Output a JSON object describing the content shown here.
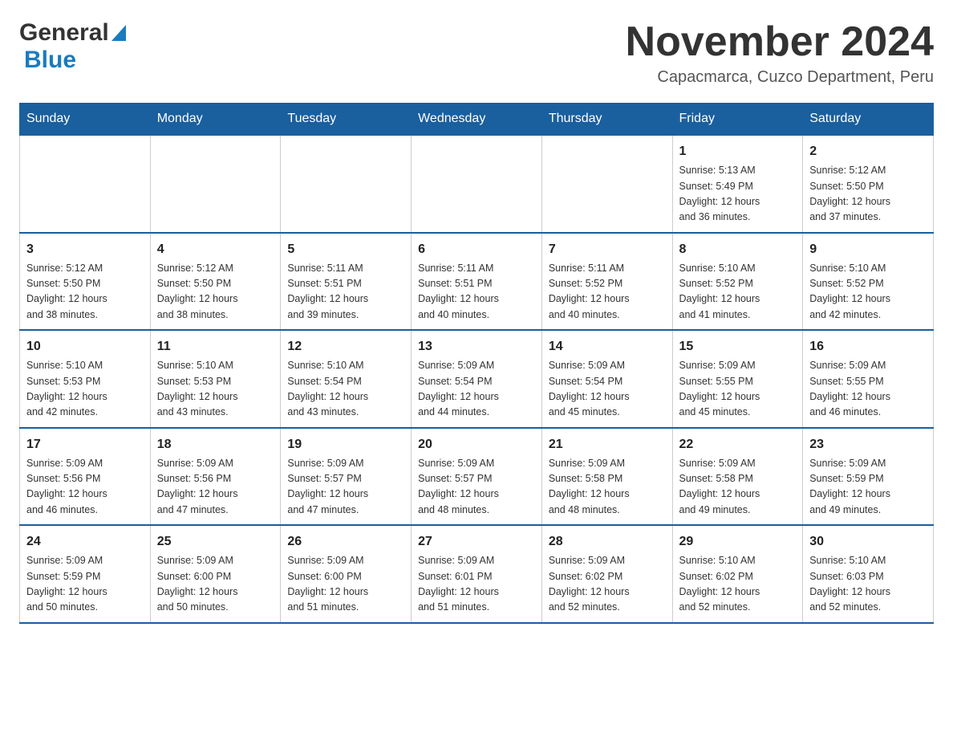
{
  "header": {
    "logo_general": "General",
    "logo_blue": "Blue",
    "title": "November 2024",
    "subtitle": "Capacmarca, Cuzco Department, Peru"
  },
  "calendar": {
    "days_of_week": [
      "Sunday",
      "Monday",
      "Tuesday",
      "Wednesday",
      "Thursday",
      "Friday",
      "Saturday"
    ],
    "weeks": [
      [
        {
          "day": "",
          "info": ""
        },
        {
          "day": "",
          "info": ""
        },
        {
          "day": "",
          "info": ""
        },
        {
          "day": "",
          "info": ""
        },
        {
          "day": "",
          "info": ""
        },
        {
          "day": "1",
          "info": "Sunrise: 5:13 AM\nSunset: 5:49 PM\nDaylight: 12 hours\nand 36 minutes."
        },
        {
          "day": "2",
          "info": "Sunrise: 5:12 AM\nSunset: 5:50 PM\nDaylight: 12 hours\nand 37 minutes."
        }
      ],
      [
        {
          "day": "3",
          "info": "Sunrise: 5:12 AM\nSunset: 5:50 PM\nDaylight: 12 hours\nand 38 minutes."
        },
        {
          "day": "4",
          "info": "Sunrise: 5:12 AM\nSunset: 5:50 PM\nDaylight: 12 hours\nand 38 minutes."
        },
        {
          "day": "5",
          "info": "Sunrise: 5:11 AM\nSunset: 5:51 PM\nDaylight: 12 hours\nand 39 minutes."
        },
        {
          "day": "6",
          "info": "Sunrise: 5:11 AM\nSunset: 5:51 PM\nDaylight: 12 hours\nand 40 minutes."
        },
        {
          "day": "7",
          "info": "Sunrise: 5:11 AM\nSunset: 5:52 PM\nDaylight: 12 hours\nand 40 minutes."
        },
        {
          "day": "8",
          "info": "Sunrise: 5:10 AM\nSunset: 5:52 PM\nDaylight: 12 hours\nand 41 minutes."
        },
        {
          "day": "9",
          "info": "Sunrise: 5:10 AM\nSunset: 5:52 PM\nDaylight: 12 hours\nand 42 minutes."
        }
      ],
      [
        {
          "day": "10",
          "info": "Sunrise: 5:10 AM\nSunset: 5:53 PM\nDaylight: 12 hours\nand 42 minutes."
        },
        {
          "day": "11",
          "info": "Sunrise: 5:10 AM\nSunset: 5:53 PM\nDaylight: 12 hours\nand 43 minutes."
        },
        {
          "day": "12",
          "info": "Sunrise: 5:10 AM\nSunset: 5:54 PM\nDaylight: 12 hours\nand 43 minutes."
        },
        {
          "day": "13",
          "info": "Sunrise: 5:09 AM\nSunset: 5:54 PM\nDaylight: 12 hours\nand 44 minutes."
        },
        {
          "day": "14",
          "info": "Sunrise: 5:09 AM\nSunset: 5:54 PM\nDaylight: 12 hours\nand 45 minutes."
        },
        {
          "day": "15",
          "info": "Sunrise: 5:09 AM\nSunset: 5:55 PM\nDaylight: 12 hours\nand 45 minutes."
        },
        {
          "day": "16",
          "info": "Sunrise: 5:09 AM\nSunset: 5:55 PM\nDaylight: 12 hours\nand 46 minutes."
        }
      ],
      [
        {
          "day": "17",
          "info": "Sunrise: 5:09 AM\nSunset: 5:56 PM\nDaylight: 12 hours\nand 46 minutes."
        },
        {
          "day": "18",
          "info": "Sunrise: 5:09 AM\nSunset: 5:56 PM\nDaylight: 12 hours\nand 47 minutes."
        },
        {
          "day": "19",
          "info": "Sunrise: 5:09 AM\nSunset: 5:57 PM\nDaylight: 12 hours\nand 47 minutes."
        },
        {
          "day": "20",
          "info": "Sunrise: 5:09 AM\nSunset: 5:57 PM\nDaylight: 12 hours\nand 48 minutes."
        },
        {
          "day": "21",
          "info": "Sunrise: 5:09 AM\nSunset: 5:58 PM\nDaylight: 12 hours\nand 48 minutes."
        },
        {
          "day": "22",
          "info": "Sunrise: 5:09 AM\nSunset: 5:58 PM\nDaylight: 12 hours\nand 49 minutes."
        },
        {
          "day": "23",
          "info": "Sunrise: 5:09 AM\nSunset: 5:59 PM\nDaylight: 12 hours\nand 49 minutes."
        }
      ],
      [
        {
          "day": "24",
          "info": "Sunrise: 5:09 AM\nSunset: 5:59 PM\nDaylight: 12 hours\nand 50 minutes."
        },
        {
          "day": "25",
          "info": "Sunrise: 5:09 AM\nSunset: 6:00 PM\nDaylight: 12 hours\nand 50 minutes."
        },
        {
          "day": "26",
          "info": "Sunrise: 5:09 AM\nSunset: 6:00 PM\nDaylight: 12 hours\nand 51 minutes."
        },
        {
          "day": "27",
          "info": "Sunrise: 5:09 AM\nSunset: 6:01 PM\nDaylight: 12 hours\nand 51 minutes."
        },
        {
          "day": "28",
          "info": "Sunrise: 5:09 AM\nSunset: 6:02 PM\nDaylight: 12 hours\nand 52 minutes."
        },
        {
          "day": "29",
          "info": "Sunrise: 5:10 AM\nSunset: 6:02 PM\nDaylight: 12 hours\nand 52 minutes."
        },
        {
          "day": "30",
          "info": "Sunrise: 5:10 AM\nSunset: 6:03 PM\nDaylight: 12 hours\nand 52 minutes."
        }
      ]
    ]
  }
}
